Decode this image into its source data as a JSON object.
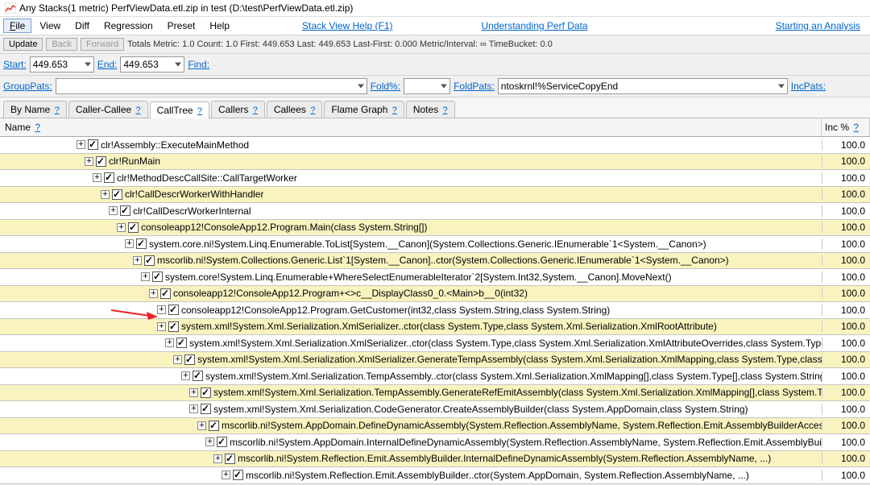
{
  "title": "Any Stacks(1 metric) PerfViewData.etl.zip in test (D:\\test\\PerfViewData.etl.zip)",
  "menus": {
    "file": "File",
    "view": "View",
    "diff": "Diff",
    "regression": "Regression",
    "preset": "Preset",
    "help": "Help",
    "stack_view_help": "Stack View Help (F1)",
    "understanding": "Understanding Perf Data",
    "starting": "Starting an Analysis"
  },
  "toolbar": {
    "update": "Update",
    "back": "Back",
    "forward": "Forward",
    "metrics": "Totals Metric: 1.0  Count: 1.0  First: 449.653 Last: 449.653  Last-First: 0.000  Metric/Interval: ∞  TimeBucket: 0.0"
  },
  "filters": {
    "start_label": "Start:",
    "start_value": "449.653",
    "end_label": "End:",
    "end_value": "449.653",
    "find_label": "Find:",
    "grouppats_label": "GroupPats:",
    "fold_label": "Fold%:",
    "foldpats_label": "FoldPats:",
    "foldpats_value": "ntoskrnl!%ServiceCopyEnd",
    "incpats_label": "IncPats:"
  },
  "tabs": {
    "byname": "By Name",
    "caller_callee": "Caller-Callee",
    "calltree": "CallTree",
    "callers": "Callers",
    "callees": "Callees",
    "flame": "Flame Graph",
    "notes": "Notes",
    "help": "?"
  },
  "headers": {
    "name": "Name",
    "inc": "Inc %"
  },
  "rows": [
    {
      "indent": 95,
      "alt": false,
      "text": "clr!Assembly::ExecuteMainMethod",
      "inc": "100.0"
    },
    {
      "indent": 105,
      "alt": true,
      "text": "clr!RunMain",
      "inc": "100.0"
    },
    {
      "indent": 115,
      "alt": false,
      "text": "clr!MethodDescCallSite::CallTargetWorker",
      "inc": "100.0"
    },
    {
      "indent": 125,
      "alt": true,
      "text": "clr!CallDescrWorkerWithHandler",
      "inc": "100.0"
    },
    {
      "indent": 135,
      "alt": false,
      "text": "clr!CallDescrWorkerInternal",
      "inc": "100.0"
    },
    {
      "indent": 145,
      "alt": true,
      "text": "consoleapp12!ConsoleApp12.Program.Main(class System.String[])",
      "inc": "100.0"
    },
    {
      "indent": 155,
      "alt": false,
      "text": "system.core.ni!System.Linq.Enumerable.ToList[System.__Canon](System.Collections.Generic.IEnumerable`1<System.__Canon>)",
      "inc": "100.0"
    },
    {
      "indent": 165,
      "alt": true,
      "text": "mscorlib.ni!System.Collections.Generic.List`1[System.__Canon]..ctor(System.Collections.Generic.IEnumerable`1<System.__Canon>)",
      "inc": "100.0"
    },
    {
      "indent": 175,
      "alt": false,
      "text": "system.core!System.Linq.Enumerable+WhereSelectEnumerableIterator`2[System.Int32,System.__Canon].MoveNext()",
      "inc": "100.0"
    },
    {
      "indent": 185,
      "alt": true,
      "text": "consoleapp12!ConsoleApp12.Program+<>c__DisplayClass0_0.<Main>b__0(int32)",
      "inc": "100.0"
    },
    {
      "indent": 195,
      "alt": false,
      "text": "consoleapp12!ConsoleApp12.Program.GetCustomer(int32,class System.String,class System.String)",
      "inc": "100.0",
      "highlight": true
    },
    {
      "indent": 195,
      "alt": true,
      "text": "system.xml!System.Xml.Serialization.XmlSerializer..ctor(class System.Type,class System.Xml.Serialization.XmlRootAttribute)",
      "inc": "100.0"
    },
    {
      "indent": 205,
      "alt": false,
      "text": "system.xml!System.Xml.Serialization.XmlSerializer..ctor(class System.Type,class System.Xml.Serialization.XmlAttributeOverrides,class System.Type[],class System.Xml.Serialization.XmlRootAttribute,class System.String)",
      "inc": "100.0"
    },
    {
      "indent": 215,
      "alt": true,
      "text": "system.xml!System.Xml.Serialization.XmlSerializer.GenerateTempAssembly(class System.Xml.Serialization.XmlMapping,class System.Type,class System.String)",
      "inc": "100.0"
    },
    {
      "indent": 225,
      "alt": false,
      "text": "system.xml!System.Xml.Serialization.TempAssembly..ctor(class System.Xml.Serialization.XmlMapping[],class System.Type[],class System.String,class System.String,class System.Security.Policy.Evidence)",
      "inc": "100.0"
    },
    {
      "indent": 235,
      "alt": true,
      "text": "system.xml!System.Xml.Serialization.TempAssembly.GenerateRefEmitAssembly(class System.Xml.Serialization.XmlMapping[],class System.Type[],class System.String,class System.Security.Policy.Evidence)",
      "inc": "100.0"
    },
    {
      "indent": 235,
      "alt": false,
      "text": "system.xml!System.Xml.Serialization.CodeGenerator.CreateAssemblyBuilder(class System.AppDomain,class System.String)",
      "inc": "100.0"
    },
    {
      "indent": 245,
      "alt": true,
      "text": "mscorlib.ni!System.AppDomain.DefineDynamicAssembly(System.Reflection.AssemblyName, System.Reflection.Emit.AssemblyBuilderAccess)",
      "inc": "100.0"
    },
    {
      "indent": 255,
      "alt": false,
      "text": "mscorlib.ni!System.AppDomain.InternalDefineDynamicAssembly(System.Reflection.AssemblyName, System.Reflection.Emit.AssemblyBuilderAccess, ...)",
      "inc": "100.0"
    },
    {
      "indent": 265,
      "alt": true,
      "text": "mscorlib.ni!System.Reflection.Emit.AssemblyBuilder.InternalDefineDynamicAssembly(System.Reflection.AssemblyName, ...)",
      "inc": "100.0"
    },
    {
      "indent": 275,
      "alt": false,
      "text": "mscorlib.ni!System.Reflection.Emit.AssemblyBuilder..ctor(System.AppDomain, System.Reflection.AssemblyName, ...)",
      "inc": "100.0"
    }
  ]
}
